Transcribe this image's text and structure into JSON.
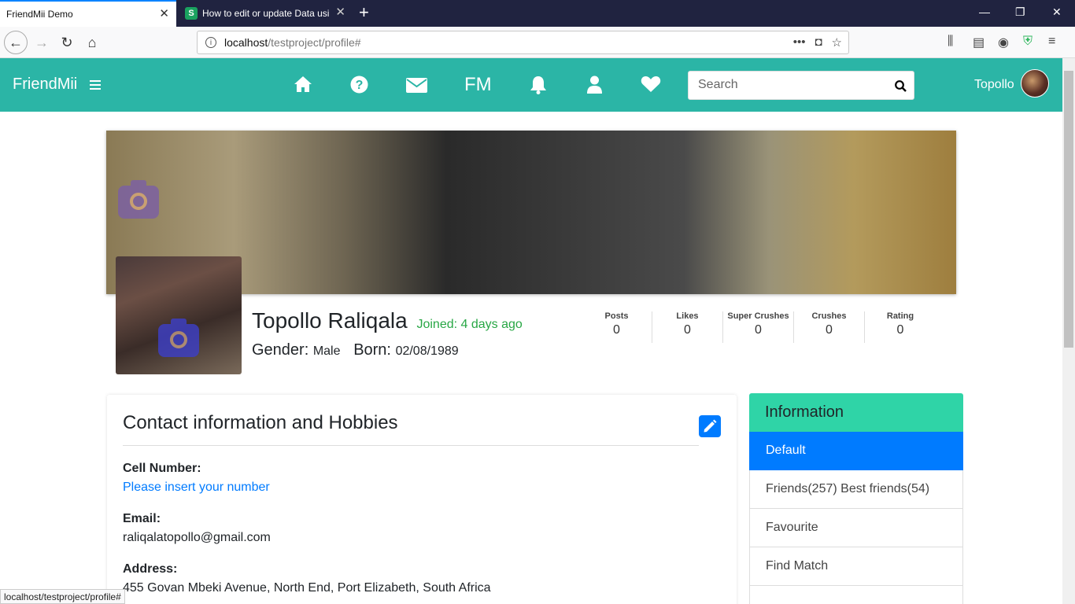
{
  "browser": {
    "tabs": [
      {
        "title": "FriendMii Demo",
        "active": true
      },
      {
        "title": "How to edit or update Data usi",
        "active": false
      }
    ],
    "url_host": "localhost",
    "url_path": "/testproject/profile#",
    "status_url": "localhost/testproject/profile#"
  },
  "app": {
    "brand": "FriendMii",
    "nav_fm": "FM",
    "search_placeholder": "Search",
    "user_name": "Topollo",
    "accent_color": "#2bb5a6"
  },
  "profile": {
    "name": "Topollo Raliqala",
    "joined": "Joined: 4 days ago",
    "gender_label": "Gender:",
    "gender": "Male",
    "born_label": "Born:",
    "born": "02/08/1989",
    "stats": [
      {
        "label": "Posts",
        "value": "0"
      },
      {
        "label": "Likes",
        "value": "0"
      },
      {
        "label": "Super Crushes",
        "value": "0"
      },
      {
        "label": "Crushes",
        "value": "0"
      },
      {
        "label": "Rating",
        "value": "0"
      }
    ]
  },
  "contact": {
    "title": "Contact information and Hobbies",
    "cell_label": "Cell Number:",
    "cell_value": "Please insert your number",
    "email_label": "Email:",
    "email_value": "raliqalatopollo@gmail.com",
    "address_label": "Address:",
    "address_value": "455 Govan Mbeki Avenue, North End, Port Elizabeth, South Africa"
  },
  "sidebar": {
    "header": "Information",
    "items": [
      {
        "label": "Default",
        "active": true
      },
      {
        "label": "Friends(257) Best friends(54)",
        "active": false
      },
      {
        "label": "Favourite",
        "active": false
      },
      {
        "label": "Find Match",
        "active": false
      }
    ]
  }
}
